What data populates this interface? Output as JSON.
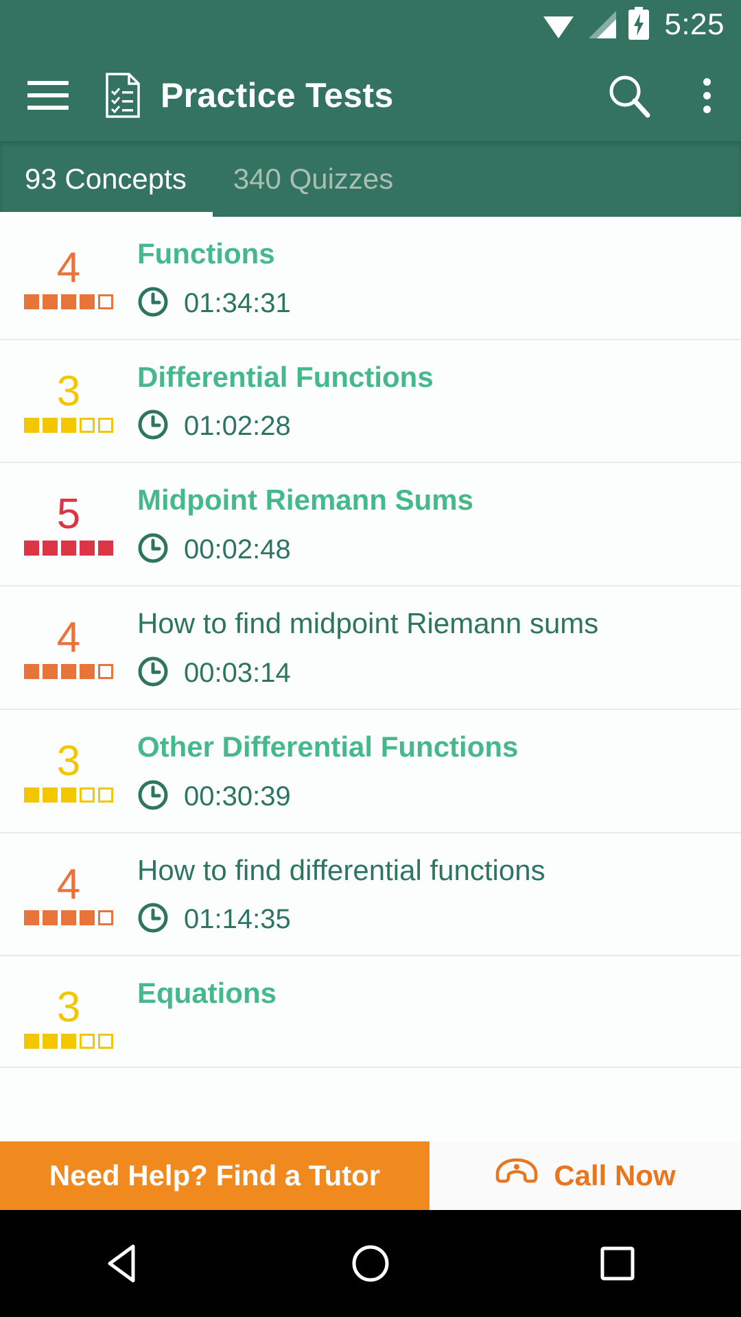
{
  "status_bar": {
    "time": "5:25",
    "icons": [
      "wifi-icon",
      "cellular-signal-icon",
      "battery-charging-icon"
    ]
  },
  "app_bar": {
    "menu_icon": "hamburger-menu-icon",
    "brand_icon": "practice-test-document-icon",
    "title": "Practice Tests",
    "search_icon": "search-icon",
    "overflow_icon": "overflow-menu-icon"
  },
  "tabs": [
    {
      "label": "93 Concepts",
      "active": true
    },
    {
      "label": "340 Quizzes",
      "active": false
    }
  ],
  "colors": {
    "primary": "#33735F",
    "accent_green": "#45B98C",
    "dark_teal": "#2E7560",
    "orange": "#E8743B",
    "yellow": "#F3C600",
    "red": "#DC3545",
    "banner_orange": "#F08A1E"
  },
  "list": {
    "clock_icon": "clock-icon",
    "rows": [
      {
        "rating": "4",
        "filled": 4,
        "total": 5,
        "color": "#E8743B",
        "title": "Functions",
        "type": "concept",
        "time": "01:34:31"
      },
      {
        "rating": "3",
        "filled": 3,
        "total": 5,
        "color": "#F3C600",
        "title": "Differential Functions",
        "type": "concept",
        "time": "01:02:28"
      },
      {
        "rating": "5",
        "filled": 5,
        "total": 5,
        "color": "#DC3545",
        "title": "Midpoint Riemann Sums",
        "type": "concept",
        "time": "00:02:48"
      },
      {
        "rating": "4",
        "filled": 4,
        "total": 5,
        "color": "#E8743B",
        "title": "How to find midpoint Riemann sums",
        "type": "sub",
        "time": "00:03:14"
      },
      {
        "rating": "3",
        "filled": 3,
        "total": 5,
        "color": "#F3C600",
        "title": "Other Differential Functions",
        "type": "concept",
        "time": "00:30:39"
      },
      {
        "rating": "4",
        "filled": 4,
        "total": 5,
        "color": "#E8743B",
        "title": "How to find differential functions",
        "type": "sub",
        "time": "01:14:35"
      },
      {
        "rating": "3",
        "filled": 3,
        "total": 5,
        "color": "#F3C600",
        "title": "Equations",
        "type": "concept",
        "time": ""
      }
    ]
  },
  "banner": {
    "main_label": "Need Help? Find a Tutor",
    "call_label": "Call Now",
    "phone_icon": "telephone-icon"
  },
  "nav_bar": {
    "back_icon": "back-triangle-icon",
    "home_icon": "home-circle-icon",
    "recents_icon": "recents-square-icon"
  }
}
